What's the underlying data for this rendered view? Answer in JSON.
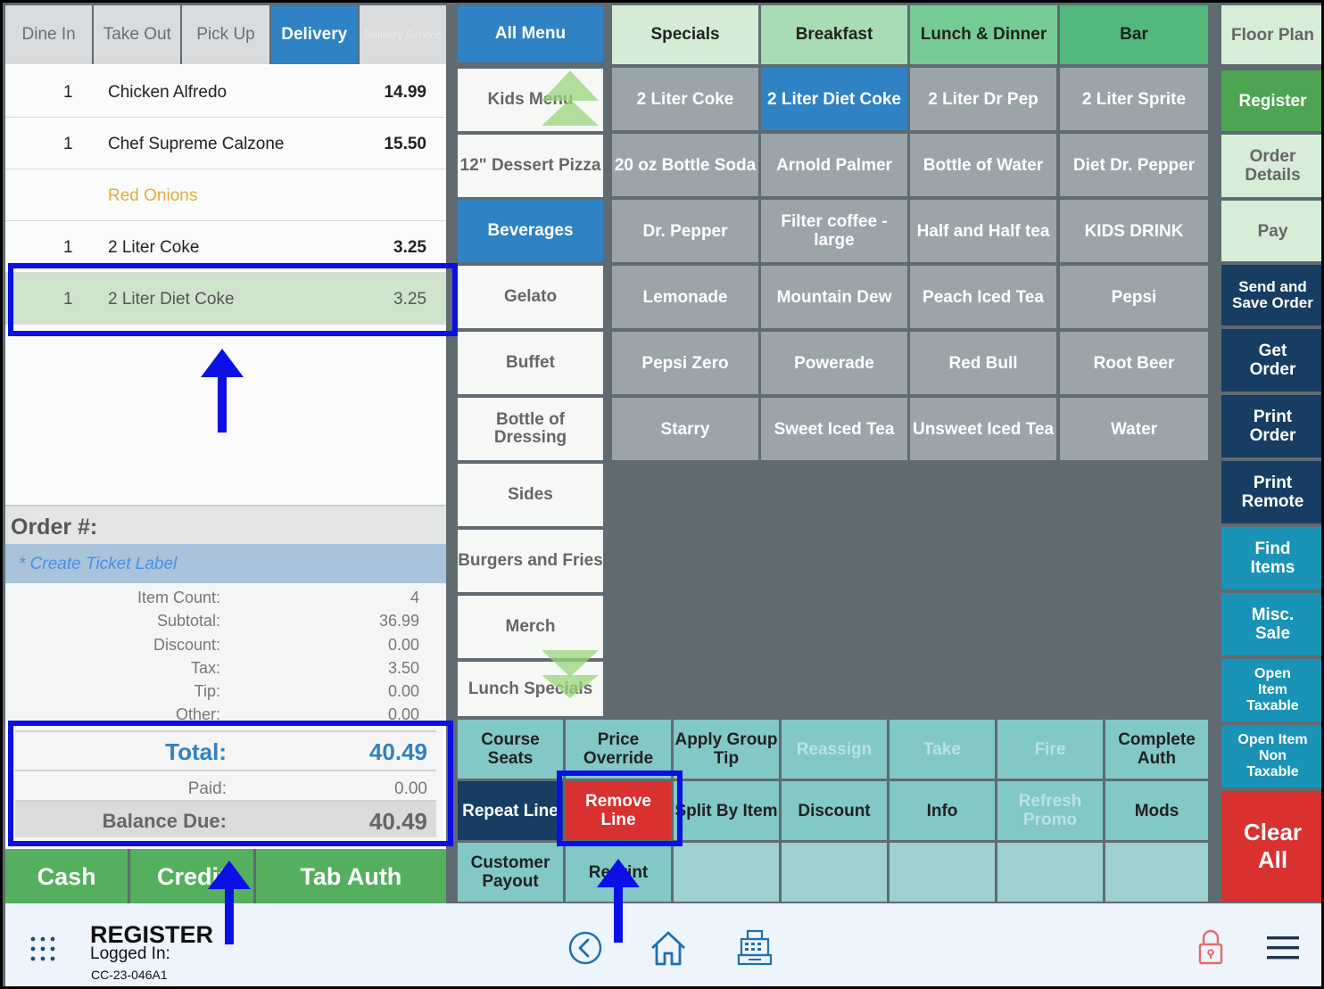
{
  "order_types": [
    {
      "label": "Dine In",
      "state": "normal"
    },
    {
      "label": "Take Out",
      "state": "normal"
    },
    {
      "label": "Pick Up",
      "state": "normal"
    },
    {
      "label": "Delivery",
      "state": "active"
    },
    {
      "label": "Delivery Service",
      "state": "disabled"
    }
  ],
  "order_items": [
    {
      "qty": "1",
      "name": "Chicken Alfredo",
      "price": "14.99"
    },
    {
      "qty": "1",
      "name": "Chef Supreme Calzone",
      "price": "15.50"
    },
    {
      "qty": "",
      "name": "Red Onions",
      "price": ""
    },
    {
      "qty": "1",
      "name": "2 Liter Coke",
      "price": "3.25"
    },
    {
      "qty": "1",
      "name": "2 Liter Diet Coke",
      "price": "3.25"
    }
  ],
  "order": {
    "number_label": "Order #:",
    "ticket_label": "* Create Ticket Label"
  },
  "totals": {
    "item_count_label": "Item Count:",
    "item_count": "4",
    "subtotal_label": "Subtotal:",
    "subtotal": "36.99",
    "discount_label": "Discount:",
    "discount": "0.00",
    "tax_label": "Tax:",
    "tax": "3.50",
    "tip_label": "Tip:",
    "tip": "0.00",
    "other_label": "Other:",
    "other": "0.00",
    "total_label": "Total:",
    "total": "40.49",
    "paid_label": "Paid:",
    "paid": "0.00",
    "balance_label": "Balance Due:",
    "balance": "40.49"
  },
  "payment": {
    "cash": "Cash",
    "credit": "Credit",
    "tab_auth": "Tab Auth"
  },
  "categories": [
    "All Menu",
    "Kids Menu",
    "12\" Dessert Pizza",
    "Beverages",
    "Gelato",
    "Buffet",
    "Bottle of Dressing",
    "Sides",
    "Burgers and Fries",
    "Merch",
    "Lunch Specials"
  ],
  "menu_tabs": [
    "Specials",
    "Breakfast",
    "Lunch & Dinner",
    "Bar"
  ],
  "menu_items": [
    "2 Liter Coke",
    "2 Liter Diet Coke",
    "2 Liter Dr Pep",
    "2 Liter Sprite",
    "20 oz Bottle Soda",
    "Arnold Palmer",
    "Bottle of Water",
    "Diet Dr. Pepper",
    "Dr. Pepper",
    "Filter coffee - large",
    "Half and Half tea",
    "KIDS DRINK",
    "Lemonade",
    "Mountain Dew",
    "Peach Iced Tea",
    "Pepsi",
    "Pepsi Zero",
    "Powerade",
    "Red Bull",
    "Root Beer",
    "Starry",
    "Sweet Iced Tea",
    "Unsweet Iced Tea",
    "Water"
  ],
  "actions": {
    "course_seats": "Course Seats",
    "price_override": "Price Override",
    "apply_group_tip": "Apply Group Tip",
    "reassign": "Reassign",
    "take": "Take",
    "fire": "Fire",
    "complete_auth": "Complete Auth",
    "repeat_line": "Repeat Line",
    "remove_line": "Remove Line",
    "split_by_item": "Split By Item",
    "discount": "Discount",
    "info": "Info",
    "refresh_promo": "Refresh Promo",
    "mods": "Mods",
    "customer_payout": "Customer Payout",
    "reprint": "Reprint"
  },
  "right": {
    "floor_plan": "Floor Plan",
    "register": "Register",
    "order_details": "Order Details",
    "pay": "Pay",
    "send_save": "Send and Save Order",
    "get_order": "Get Order",
    "print_order": "Print Order",
    "print_remote": "Print Remote",
    "find_items": "Find Items",
    "misc_sale": "Misc. Sale",
    "open_taxable": "Open Item Taxable",
    "open_non_taxable": "Open Item Non Taxable",
    "clear_all": "Clear All"
  },
  "footer": {
    "title": "REGISTER",
    "logged_in": "Logged In:",
    "terminal_id": "CC-23-046A1"
  },
  "colors": {
    "accent_blue": "#2f82c3",
    "highlight": "#0a10e6",
    "remove_red": "#d93030",
    "pay_green": "#54b05e"
  }
}
